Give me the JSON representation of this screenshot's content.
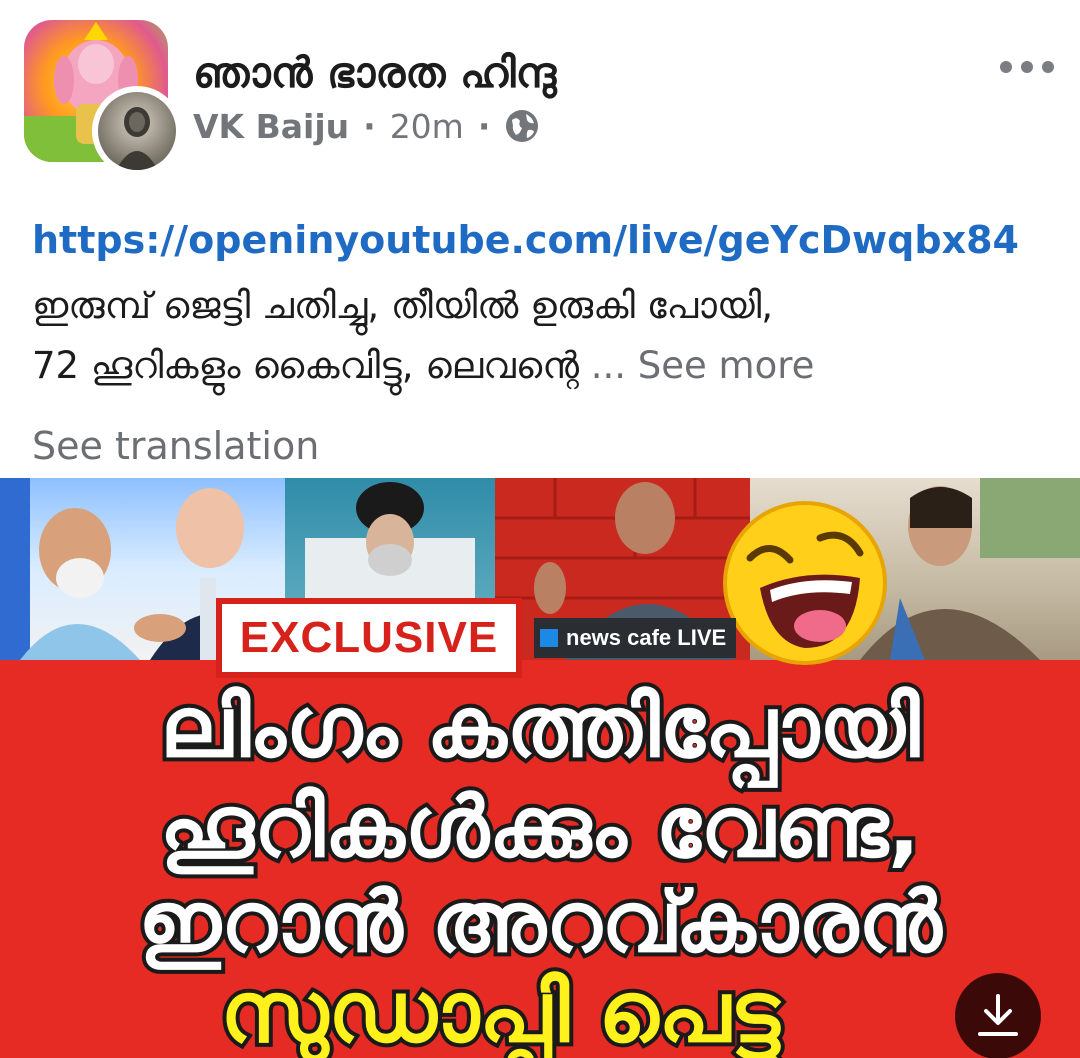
{
  "post": {
    "group_name": "ഞാൻ ഭാരത ഹിന്ദു",
    "author": "VK Baiju",
    "time": "20m",
    "separator": "·",
    "link": "https://openinyoutube.com/live/geYcDwqbx84",
    "body_line_1": "ഇരുമ്പ് ജെട്ടി ചതിച്ചു, തീയിൽ ഉരുകി പോയി,",
    "body_line_2": "72 ഹൂറികളും കൈവിട്ടു, ലെവന്റെ",
    "see_more": "... See more",
    "see_translation": "See translation"
  },
  "icons": {
    "more": "more-options-icon",
    "audience": "globe-icon",
    "download": "download-icon",
    "emoji": "laughing-emoji-icon"
  },
  "thumbnail": {
    "badge": "EXCLUSIVE",
    "channel_label": "news cafe LIVE",
    "headline_line_1": "ലിംഗം കത്തിപ്പോയി",
    "headline_line_2": "ഹൂറികൾക്കും വേണ്ട,",
    "headline_line_3": "ഇറാൻ അറവ്കാരൻ",
    "headline_line_4": "സുഡാപ്പി പെട്ടു"
  },
  "colors": {
    "link": "#1f6bc4",
    "thumbnail_red": "#e52b23",
    "headline_yellow": "#fff21c",
    "badge_red": "#d7211b"
  }
}
